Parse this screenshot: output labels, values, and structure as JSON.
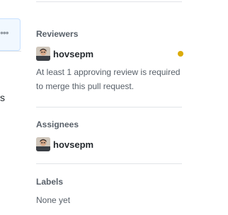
{
  "left_fragment": {
    "more_glyph": "•••",
    "trailing_text": "s"
  },
  "reviewers": {
    "heading": "Reviewers",
    "user": "hovsepm",
    "status": "pending",
    "status_color": "#dbab09",
    "note": "At least 1 approving review is required to merge this pull request."
  },
  "assignees": {
    "heading": "Assignees",
    "user": "hovsepm"
  },
  "labels": {
    "heading": "Labels",
    "value": "None yet"
  }
}
